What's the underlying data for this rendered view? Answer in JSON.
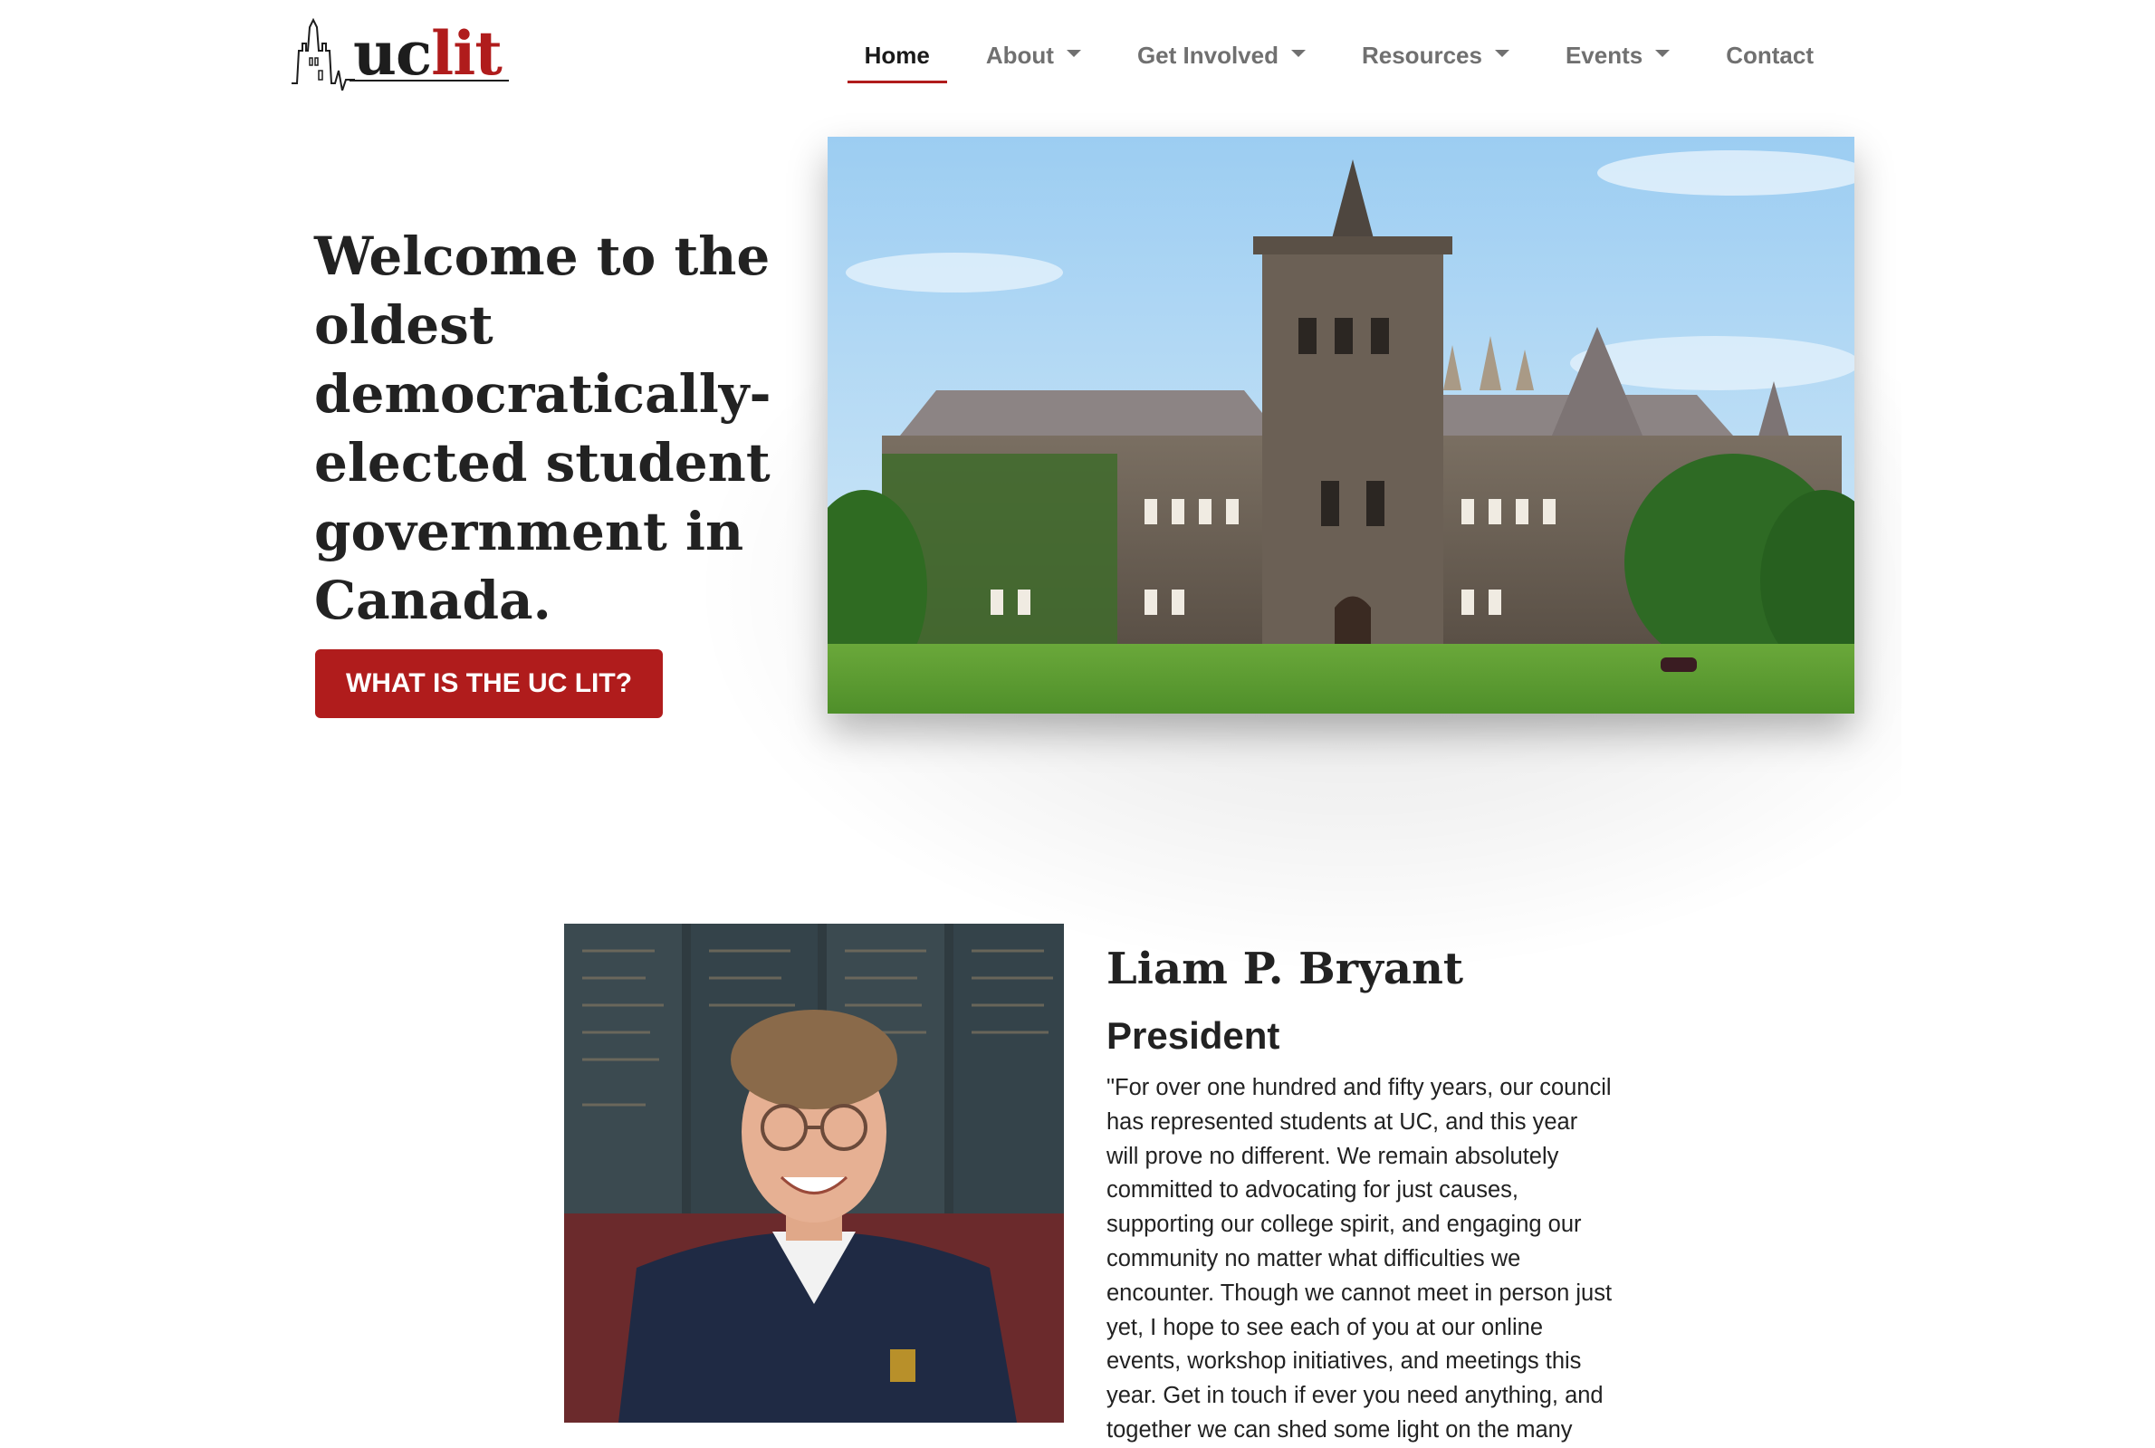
{
  "logo": {
    "uc": "uc",
    "lit": "lit"
  },
  "nav": {
    "items": [
      {
        "label": "Home",
        "active": true,
        "dropdown": false
      },
      {
        "label": "About",
        "active": false,
        "dropdown": true
      },
      {
        "label": "Get Involved",
        "active": false,
        "dropdown": true
      },
      {
        "label": "Resources",
        "active": false,
        "dropdown": true
      },
      {
        "label": "Events",
        "active": false,
        "dropdown": true
      },
      {
        "label": "Contact",
        "active": false,
        "dropdown": false
      }
    ]
  },
  "hero": {
    "title": "Welcome to the oldest democratically-elected student government in Canada.",
    "cta_label": "WHAT IS THE UC LIT?"
  },
  "president": {
    "name": "Liam P. Bryant",
    "role": "President",
    "quote": "\"For over one hundred and fifty years, our council has represented students at UC, and this year will prove no different. We remain absolutely committed to advocating for just causes, supporting our college spirit, and engaging our community no matter what difficulties we encounter. Though we cannot meet in person just yet, I hope to see each of you at our online events, workshop initiatives, and meetings this year. Get in touch if ever you need anything, and together we can shed some light on the many"
  },
  "colors": {
    "accent": "#b01c1c",
    "nav_inactive": "#707070",
    "text": "#222222"
  }
}
